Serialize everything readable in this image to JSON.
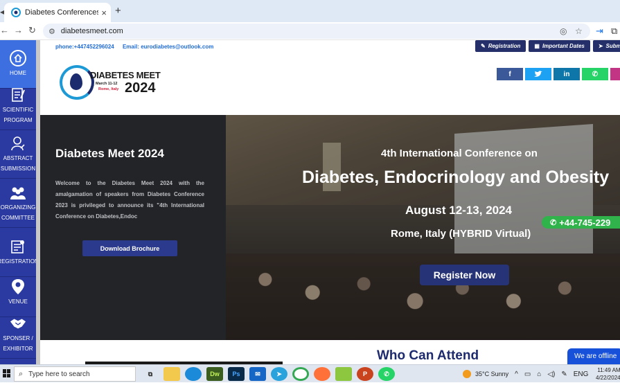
{
  "browser": {
    "tab_title": "Diabetes Conferences | Obesity",
    "tab_close": "×",
    "new_tab": "+",
    "url": "diabetesmeet.com"
  },
  "contact": {
    "phone": "phone:+447452296024",
    "email": "Email: eurodiabetes@outlook.com"
  },
  "top_links": [
    {
      "icon": "pencil-icon",
      "label": "Registration"
    },
    {
      "icon": "calendar-icon",
      "label": "Important Dates"
    },
    {
      "icon": "send-icon",
      "label": "Submit Ab"
    }
  ],
  "logo": {
    "title": "DIABETES MEET",
    "dates": "March 11-12",
    "place": "Rome, Italy",
    "year": "2024"
  },
  "socials": [
    {
      "name": "facebook-icon",
      "glyph": "f",
      "color": "#3b5998"
    },
    {
      "name": "twitter-icon",
      "glyph": "t",
      "color": "#1da1f2"
    },
    {
      "name": "linkedin-icon",
      "glyph": "in",
      "color": "#0e76a8"
    },
    {
      "name": "whatsapp-icon",
      "glyph": "✆",
      "color": "#25d366"
    },
    {
      "name": "instagram-icon",
      "glyph": "",
      "color": "#c13584"
    }
  ],
  "sidenav": [
    {
      "label": "HOME",
      "icon": "home-icon"
    },
    {
      "label": "SCIENTIFIC PROGRAM",
      "line1": "SCIENTIFIC",
      "line2": "PROGRAM",
      "icon": "program-icon"
    },
    {
      "label": "ABSTRACT SUBMISSION",
      "line1": "ABSTRACT",
      "line2": "SUBMISSION",
      "icon": "abstract-icon"
    },
    {
      "label": "ORGANIZING COMMITTEE",
      "line1": "ORGANIZING",
      "line2": "COMMITTEE",
      "icon": "committee-icon"
    },
    {
      "label": "REGISTRATION",
      "icon": "registration-icon"
    },
    {
      "label": "VENUE",
      "icon": "venue-pin-icon"
    },
    {
      "label": "SPONSER / EXHIBITOR",
      "line1": "SPONSER /",
      "line2": "EXHIBITOR",
      "icon": "handshake-icon"
    }
  ],
  "hero_left": {
    "heading": "Diabetes Meet 2024",
    "body": "Welcome to the Diabetes Meet 2024 with the amalgamation of speakers from Diabetes Conference 2023 is privileged to announce its \"4th International Conference on Diabetes,Endoc",
    "button": "Download Brochure"
  },
  "hero_right": {
    "subtitle": "4th International Conference on",
    "title": "Diabetes, Endocrinology and Obesity",
    "date": "August 12-13, 2024",
    "location": "Rome, Italy (HYBRID Virtual)",
    "button": "Register Now",
    "whatsapp": "+44-745-229"
  },
  "section": {
    "who_heading": "Who Can Attend",
    "chat_status": "We are offline"
  },
  "taskbar": {
    "search_placeholder": "Type here to search",
    "weather": "35°C  Sunny",
    "lang": "ENG",
    "time": "11:49 AM",
    "date": "4/22/2024"
  },
  "colors": {
    "nav_bg": "#2b3aa0",
    "nav_active": "#3d6fe0",
    "button_bg": "#263377",
    "accent_link": "#1f6bd6",
    "whatsapp_green": "#2fb34a"
  }
}
